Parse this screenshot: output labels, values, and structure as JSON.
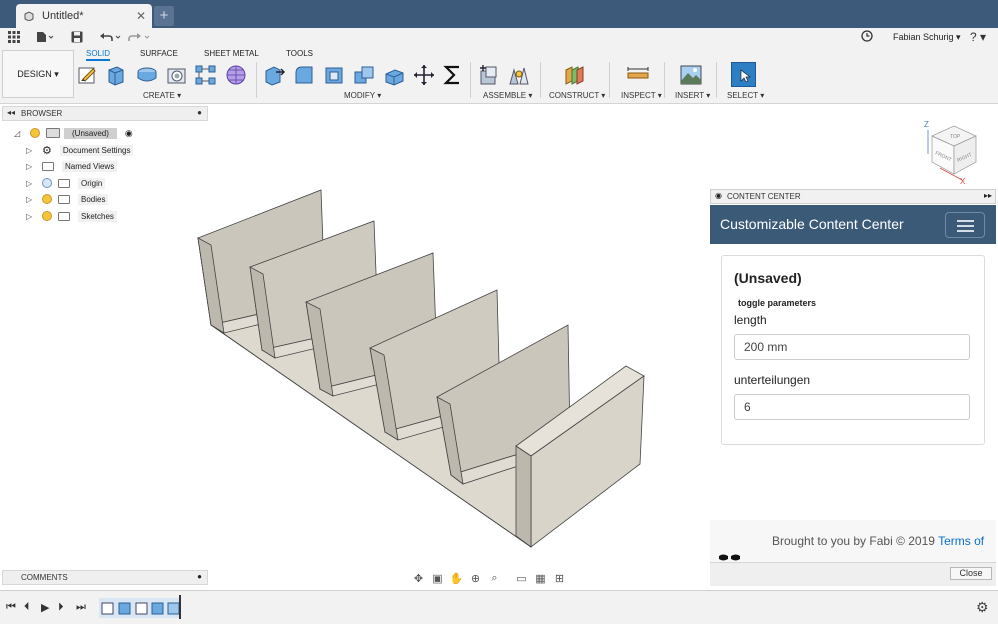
{
  "document": {
    "tab_title": "Untitled*",
    "close_glyph": "✕",
    "new_tab_glyph": "+"
  },
  "user": {
    "name": "Fabian Schurig ▾",
    "help": "? ▾"
  },
  "workspace": {
    "label": "DESIGN ▾"
  },
  "ribbon": {
    "tabs": [
      "SOLID",
      "SURFACE",
      "SHEET METAL",
      "TOOLS"
    ],
    "active_tab": "SOLID",
    "groups": {
      "create": "CREATE ▾",
      "modify": "MODIFY ▾",
      "assemble": "ASSEMBLE ▾",
      "construct": "CONSTRUCT ▾",
      "inspect": "INSPECT ▾",
      "insert": "INSERT ▾",
      "select": "SELECT ▾"
    }
  },
  "browser": {
    "title": "BROWSER",
    "root": "(Unsaved)",
    "items": [
      "Document Settings",
      "Named Views",
      "Origin",
      "Bodies",
      "Sketches"
    ]
  },
  "content_center": {
    "panel_title": "CONTENT CENTER",
    "brand": "Customizable Content Center",
    "document_name": "(Unsaved)",
    "toggle_label": "toggle parameters",
    "fields": [
      {
        "label": "length",
        "value": "200 mm"
      },
      {
        "label": "unterteilungen",
        "value": "6"
      }
    ],
    "footer_text": "Brought to you by Fabi © 2019 ",
    "footer_link": "Terms of",
    "close_label": "Close"
  },
  "comments": {
    "title": "COMMENTS"
  },
  "viewcube": {
    "top": "TOP",
    "front": "FRONT",
    "right": "RIGHT",
    "axis_z": "Z",
    "axis_x": "X"
  },
  "colors": {
    "tab_bar": "#3d5a7a",
    "accent": "#0a78d4",
    "cc_bar": "#3b5a78",
    "model_face": "#cbc6bb"
  }
}
